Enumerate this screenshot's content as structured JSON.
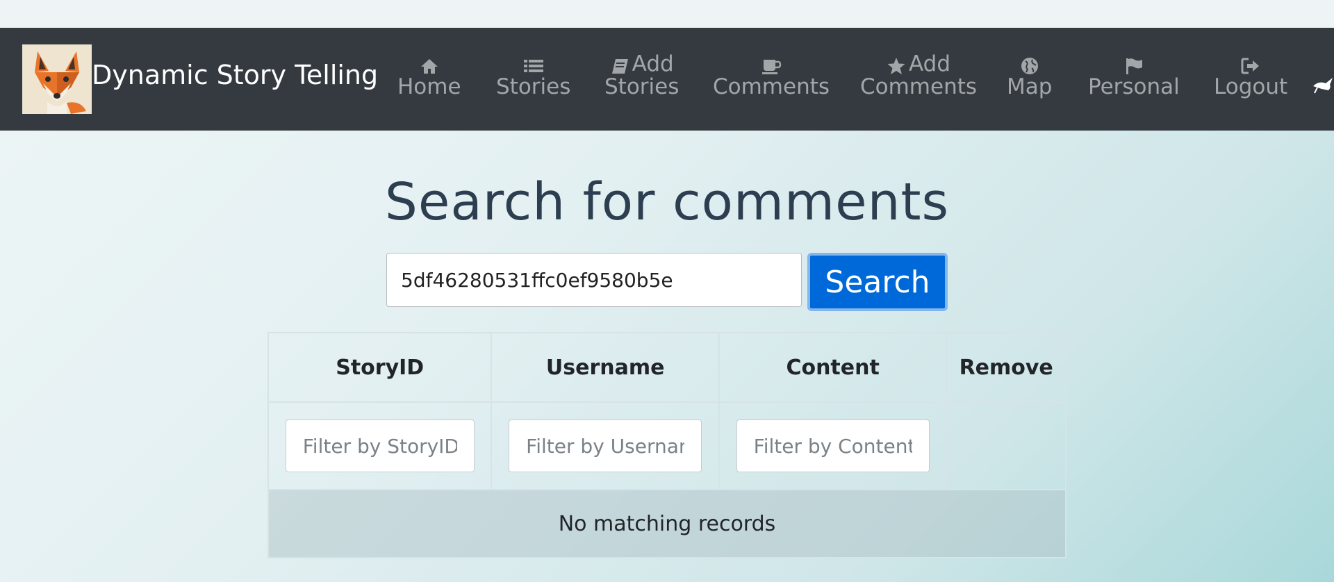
{
  "brand": {
    "title": "Dynamic Story Telling",
    "logo_icon": "fox-logo-icon"
  },
  "nav": {
    "items": [
      {
        "icon": "home-icon",
        "line1": "",
        "line2": "Home"
      },
      {
        "icon": "list-icon",
        "line1": "",
        "line2": "Stories"
      },
      {
        "icon": "book-icon",
        "line1": "Add",
        "line2": "Stories"
      },
      {
        "icon": "coffee-cup-icon",
        "line1": "",
        "line2": "Comments"
      },
      {
        "icon": "star-icon",
        "line1": "Add",
        "line2": "Comments"
      },
      {
        "icon": "globe-icon",
        "line1": "",
        "line2": "Map"
      },
      {
        "icon": "flag-icon",
        "line1": "",
        "line2": "Personal"
      },
      {
        "icon": "logout-icon",
        "line1": "",
        "line2": "Logout"
      }
    ]
  },
  "main": {
    "title": "Search for comments",
    "search": {
      "value": "5df46280531ffc0ef9580b5e",
      "button_label": "Search"
    },
    "table": {
      "columns": [
        "StoryID",
        "Username",
        "Content",
        "Remove"
      ],
      "filters": [
        {
          "placeholder": "Filter by StoryID"
        },
        {
          "placeholder": "Filter by Username"
        },
        {
          "placeholder": "Filter by Content"
        }
      ],
      "empty_message": "No matching records"
    }
  },
  "colors": {
    "navbar": "#343a40",
    "primary": "#0069d9",
    "title": "#2c3e50"
  }
}
